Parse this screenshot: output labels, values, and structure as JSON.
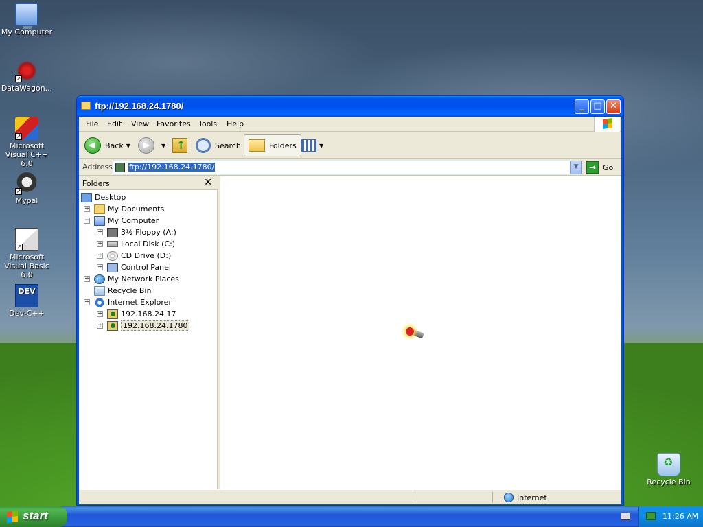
{
  "desktop": {
    "icons": [
      {
        "label": "My Computer",
        "icon": "my-computer-icon"
      },
      {
        "label": "DataWagon...",
        "icon": "datawagon-icon"
      },
      {
        "label": "Microsoft Visual C++ 6.0",
        "icon": "visual-cpp-icon"
      },
      {
        "label": "Mypal",
        "icon": "mypal-icon"
      },
      {
        "label": "Microsoft Visual Basic 6.0",
        "icon": "visual-basic-icon"
      },
      {
        "label": "Dev-C++",
        "icon": "dev-cpp-icon",
        "badge": "DEV"
      },
      {
        "label": "Recycle Bin",
        "icon": "recycle-bin-icon"
      }
    ]
  },
  "window": {
    "title": "ftp://192.168.24.1780/",
    "menu": [
      "File",
      "Edit",
      "View",
      "Favorites",
      "Tools",
      "Help"
    ],
    "toolbar": {
      "back_label": "Back",
      "search_label": "Search",
      "folders_label": "Folders"
    },
    "address": {
      "label": "Address",
      "value": "ftp://192.168.24.1780/",
      "go_label": "Go"
    },
    "folders_pane": {
      "title": "Folders",
      "close_glyph": "✕",
      "tree": [
        {
          "label": "Desktop",
          "icon": "desktop-icon",
          "expander": "none",
          "level": 0
        },
        {
          "label": "My Documents",
          "icon": "my-documents-icon",
          "expander": "+",
          "level": 1
        },
        {
          "label": "My Computer",
          "icon": "my-computer-icon",
          "expander": "−",
          "level": 1
        },
        {
          "label": "3½ Floppy (A:)",
          "icon": "floppy-icon",
          "expander": "+",
          "level": 2
        },
        {
          "label": "Local Disk (C:)",
          "icon": "hard-disk-icon",
          "expander": "+",
          "level": 2
        },
        {
          "label": "CD Drive (D:)",
          "icon": "cd-drive-icon",
          "expander": "+",
          "level": 2
        },
        {
          "label": "Control Panel",
          "icon": "control-panel-icon",
          "expander": "+",
          "level": 2
        },
        {
          "label": "My Network Places",
          "icon": "network-icon",
          "expander": "+",
          "level": 1
        },
        {
          "label": "Recycle Bin",
          "icon": "recycle-bin-icon",
          "expander": "none",
          "level": 1
        },
        {
          "label": "Internet Explorer",
          "icon": "internet-explorer-icon",
          "expander": "+",
          "level": 1
        },
        {
          "label": "192.168.24.17",
          "icon": "ftp-site-icon",
          "expander": "+",
          "level": 2
        },
        {
          "label": "192.168.24.1780",
          "icon": "ftp-site-icon",
          "expander": "+",
          "level": 2,
          "selected": true
        }
      ]
    },
    "status": {
      "zone": "Internet"
    }
  },
  "taskbar": {
    "start_label": "start",
    "clock": "11:26 AM"
  }
}
